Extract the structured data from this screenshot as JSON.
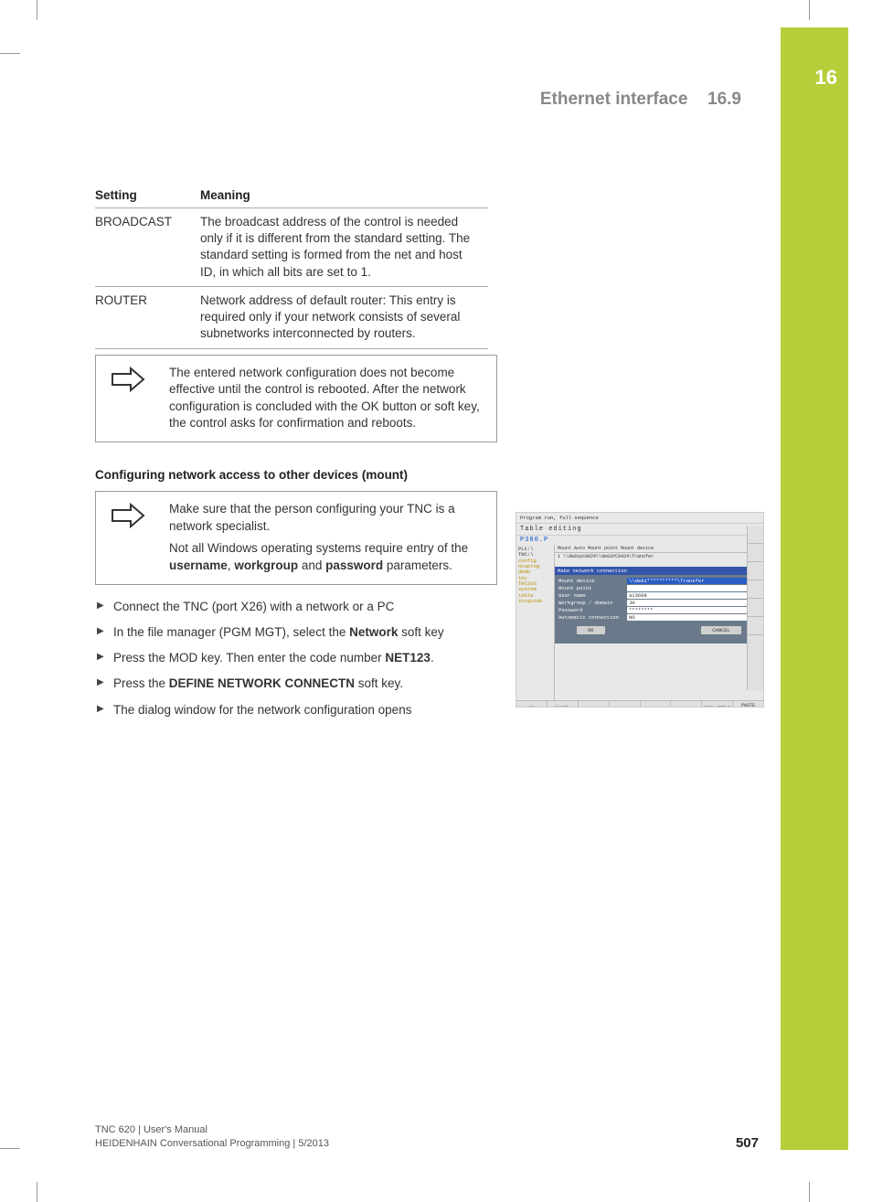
{
  "chapter_tab": "16",
  "header": {
    "title": "Ethernet interface",
    "section": "16.9"
  },
  "table": {
    "col1": "Setting",
    "col2": "Meaning",
    "rows": [
      {
        "setting": "BROADCAST",
        "meaning": "The broadcast address of the control is needed only if it is different from the standard setting. The standard setting is formed from the net and host ID, in which all bits are set to 1."
      },
      {
        "setting": "ROUTER",
        "meaning": "Network address of default router: This entry is required only if your network consists of several subnetworks interconnected by routers."
      }
    ]
  },
  "note1": "The entered network configuration does not become effective until the control is rebooted. After the network configuration is concluded with the OK button or soft key, the control asks for confirmation and reboots.",
  "subheading": "Configuring network access to other devices (mount)",
  "note2": {
    "p1": "Make sure that the person configuring your TNC is a network specialist.",
    "p2_a": "Not all Windows operating systems require entry of the ",
    "p2_b1": "username",
    "p2_c1": ", ",
    "p2_b2": "workgroup",
    "p2_c2": " and ",
    "p2_b3": "password",
    "p2_d": " parameters."
  },
  "steps": {
    "s1": "Connect the TNC (port X26) with a network or a PC",
    "s2_a": "In the file manager (PGM MGT), select the ",
    "s2_b": "Network",
    "s2_c": " soft key",
    "s3_a": "Press the MOD key. Then enter the code number ",
    "s3_b": "NET123",
    "s3_c": ".",
    "s4_a": "Press the ",
    "s4_b": "DEFINE NETWORK CONNECTN",
    "s4_c": " soft key.",
    "s5": "The dialog window for the network configuration opens"
  },
  "screenshot": {
    "header": "Program run, full sequence",
    "title": "Table editing",
    "file": "P380.P",
    "tree": [
      "PLC:\\",
      "TNC:\\",
      " config",
      " ncuprog",
      "  demo",
      "  tnc",
      "  THC320",
      " system",
      " table",
      " tncguide"
    ],
    "cols": "Mount   Auto Mount point Mount device",
    "row1": "1                       \\\\de01pc0024\\\\de01PC0424\\Transfer",
    "dialog": {
      "title": "Make network connection",
      "fields": [
        {
          "lbl": "Mount device",
          "val": "\\\\de01**********\\Transfer",
          "hl": true
        },
        {
          "lbl": "Mount point",
          "val": ""
        },
        {
          "lbl": "User name",
          "val": "a13608"
        },
        {
          "lbl": "Workgroup / domain",
          "val": "JH"
        },
        {
          "lbl": "Password",
          "val": "********"
        },
        {
          "lbl": "Automatic connection",
          "val": "NO"
        }
      ],
      "ok": "OK",
      "cancel": "CANCEL"
    },
    "softkeys": [
      "OK",
      "CANCEL",
      "",
      "",
      "",
      "",
      "COPY FIELD",
      "PASTE FIELD"
    ]
  },
  "footer": {
    "line1": "TNC 620 | User's Manual",
    "line2": "HEIDENHAIN Conversational Programming | 5/2013",
    "page": "507"
  }
}
